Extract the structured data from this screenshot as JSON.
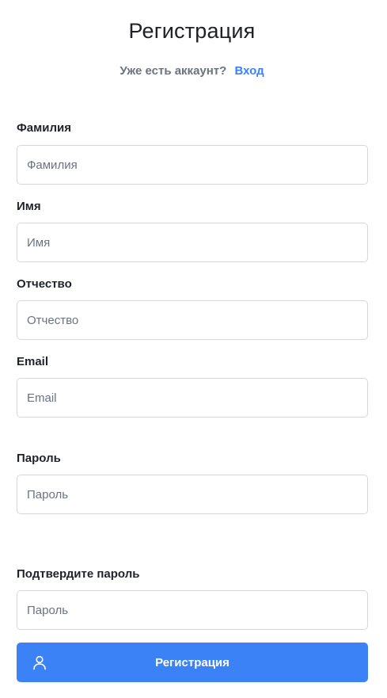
{
  "page": {
    "title": "Регистрация",
    "login_prompt": "Уже есть аккаунт?",
    "login_link": "Вход"
  },
  "fields": {
    "last_name": {
      "label": "Фамилия",
      "placeholder": "Фамилия",
      "value": ""
    },
    "first_name": {
      "label": "Имя",
      "placeholder": "Имя",
      "value": ""
    },
    "middle_name": {
      "label": "Отчество",
      "placeholder": "Отчество",
      "value": ""
    },
    "email": {
      "label": "Email",
      "placeholder": "Email",
      "value": ""
    },
    "password": {
      "label": "Пароль",
      "placeholder": "Пароль",
      "value": ""
    },
    "password_confirm": {
      "label": "Подтвердите пароль",
      "placeholder": "Пароль",
      "value": ""
    }
  },
  "submit": {
    "label": "Регистрация",
    "icon": "user-icon"
  },
  "colors": {
    "accent": "#3b82f6",
    "muted_text": "#6b7280",
    "border": "#d4d7dc"
  }
}
